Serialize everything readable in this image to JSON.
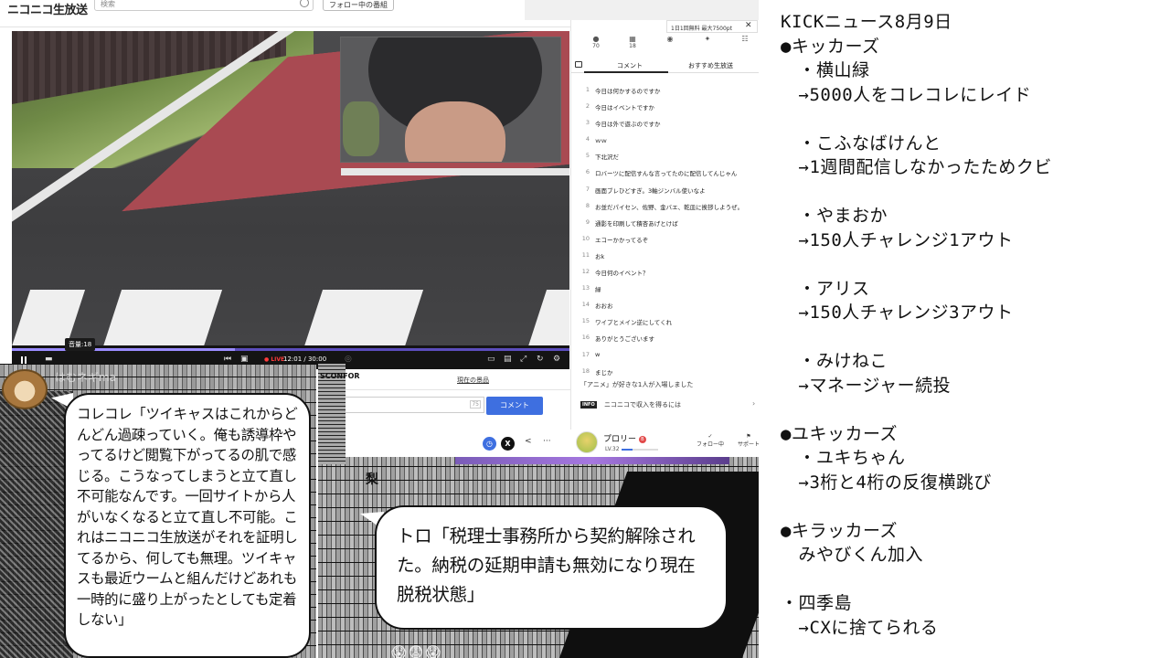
{
  "header": {
    "logo": "ニコニコ生放送",
    "search_placeholder": "検索",
    "follow_button": "フォロー中の番組"
  },
  "video": {
    "volume_tooltip": "音量:18",
    "live_label": "LIVE",
    "time": "12:01 / 30:00",
    "progress_fraction": 0.4
  },
  "panel": {
    "note": "1日1回無料 最大7500pt",
    "stats": [
      {
        "label": "70"
      },
      {
        "label": "18"
      },
      {
        "label": ""
      },
      {
        "label": ""
      },
      {
        "label": ""
      }
    ],
    "tabs": {
      "comments": "コメント",
      "recommended": "おすすめ生放送"
    },
    "comments": [
      {
        "num": "1",
        "text": "今日は何かするのですか"
      },
      {
        "num": "2",
        "text": "今日はイベントですか"
      },
      {
        "num": "3",
        "text": "今日は外で遊ぶのですか"
      },
      {
        "num": "4",
        "text": "ｗｗ"
      },
      {
        "num": "5",
        "text": "下北沢だ"
      },
      {
        "num": "6",
        "text": "ロバーツに配信すんな言ってたのに配信してんじゃん"
      },
      {
        "num": "7",
        "text": "画面ブレひどすぎ。3軸ジンバル使いなよ"
      },
      {
        "num": "8",
        "text": "お並だパイセン、佐野、金バエ、乾皿に挨拶しようぜ。"
      },
      {
        "num": "9",
        "text": "通影を印刷して積杏あげとけば"
      },
      {
        "num": "10",
        "text": "エコーかかってるぞ"
      },
      {
        "num": "11",
        "text": "おk"
      },
      {
        "num": "12",
        "text": "今日何のイベント？"
      },
      {
        "num": "13",
        "text": "緑"
      },
      {
        "num": "14",
        "text": "おおお"
      },
      {
        "num": "15",
        "text": "ワイプとメイン逆にしてくれ"
      },
      {
        "num": "16",
        "text": "ありがとうございます"
      },
      {
        "num": "17",
        "text": "w"
      },
      {
        "num": "18",
        "text": "まじか"
      }
    ],
    "footer_text": "「アニメ」が好きな1人が入場しました",
    "info_badge": "INFO",
    "info_text": "ニコニコで収入を得るには"
  },
  "input_area": {
    "product_link": "現在の景品",
    "char_count": "75",
    "comment_button": "コメント"
  },
  "user": {
    "name": "プロリー",
    "badge": "B",
    "level": "LV.32",
    "level_fraction": 0.3,
    "follow_state": "フォロー中",
    "support_state": "サポート"
  },
  "manga": {
    "hamster_name": "はむネギma",
    "bubble1": "コレコレ「ツイキャスはこれからどんどん過疎っていく。俺も誘導枠やってるけど閲覧下がってるの肌で感じる。こうなってしまうと立て直し不可能なんです。一回サイトから人がいなくなると立て直し不可能。これはニコニコ生放送がそれを証明してるから、何しても無理。ツイキャスも最近ウームと組んだけどあれも一時的に盛り上がったとしても定着しない」",
    "sign_text": "SCONFOR",
    "right_label": "梨",
    "bubble2": "トロ「税理士事務所から契約解除された。納税の延期申請も無効になり現在脱税状態」",
    "faces": "😱😨😱"
  },
  "news": {
    "lines": [
      "KICKニュース8月9日",
      "●キッカーズ",
      "　・横山緑",
      "　→5000人をコレコレにレイド",
      "",
      "　・こふなばけんと",
      "　→1週間配信しなかったためクビ",
      "",
      "　・やまおか",
      "　→150人チャレンジ1アウト",
      "",
      "　・アリス",
      "　→150人チャレンジ3アウト",
      "",
      "　・みけねこ",
      "　→マネージャー続投",
      "",
      "●ユキッカーズ",
      "　・ユキちゃん",
      "　→3桁と4桁の反復横跳び",
      "",
      "●キラッカーズ",
      "　みやびくん加入",
      "",
      "・四季島",
      "　→CXに捨てられる"
    ]
  }
}
